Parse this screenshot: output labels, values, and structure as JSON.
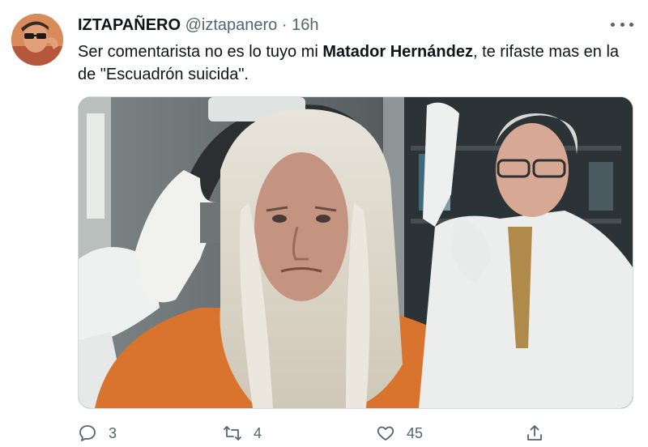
{
  "tweet": {
    "display_name": "IZTAPAÑERO",
    "handle": "@iztapanero",
    "separator": "·",
    "time": "16h",
    "text_before": "Ser comentarista no es lo tuyo mi ",
    "text_bold": "Matador Hernández",
    "text_after": ", te rifaste mas en la de \"Escuadrón suicida\"."
  },
  "actions": {
    "reply_count": "3",
    "retweet_count": "4",
    "like_count": "45"
  },
  "icons": {
    "reply": "reply-icon",
    "retweet": "retweet-icon",
    "like": "heart-icon",
    "share": "share-icon",
    "more": "more-icon"
  },
  "colors": {
    "text": "#0f1419",
    "muted": "#536471",
    "border": "#cfd9de"
  }
}
